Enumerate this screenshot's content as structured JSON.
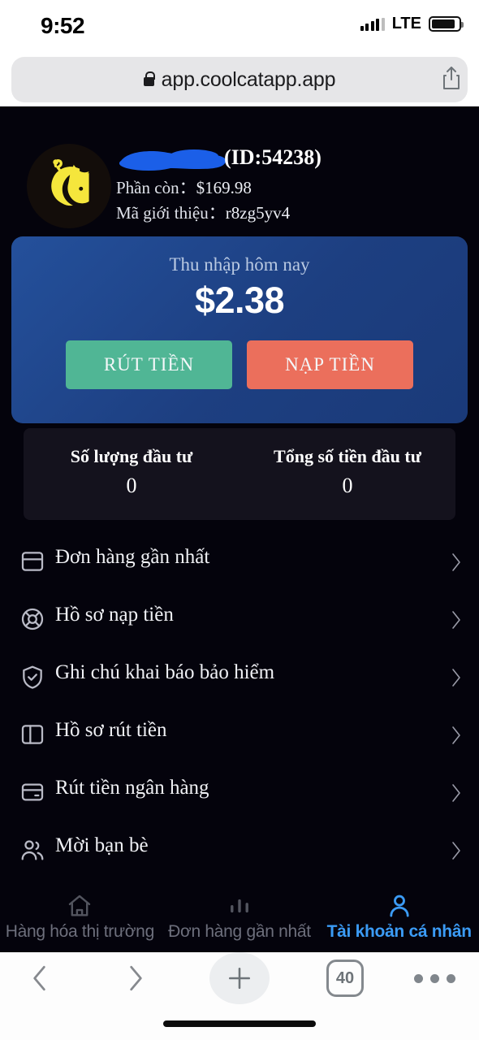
{
  "status_bar": {
    "time": "9:52",
    "network": "LTE"
  },
  "browser": {
    "url": "app.coolcatapp.app",
    "lock_icon": "lock-icon",
    "share_icon": "share-icon",
    "toolbar": {
      "back_icon": "chevron-left-icon",
      "forward_icon": "chevron-right-icon",
      "new_tab_icon": "plus-icon",
      "tab_count": "40",
      "more_icon": "ellipsis-icon"
    }
  },
  "profile": {
    "avatar_icon": "cat-moon-logo",
    "username_redacted": true,
    "id_label": "(ID:54238)",
    "balance_label": "Phần còn：",
    "balance_value": "$169.98",
    "referral_label": "Mã giới thiệu：",
    "referral_value": "r8zg5yv4"
  },
  "earnings_card": {
    "title": "Thu nhập hôm nay",
    "amount": "$2.38",
    "withdraw_button": "RÚT TIỀN",
    "deposit_button": "NẠP TIỀN",
    "card_color": "#1d4289",
    "withdraw_color": "#50b695",
    "deposit_color": "#eb6f5c"
  },
  "stats": [
    {
      "title": "Số lượng đầu tư",
      "value": "0"
    },
    {
      "title": "Tổng số tiền đầu tư",
      "value": "0"
    }
  ],
  "menu": [
    {
      "label": "Đơn hàng gần nhất",
      "icon": "rows-panel-icon"
    },
    {
      "label": "Hồ sơ nạp tiền",
      "icon": "lifebuoy-icon"
    },
    {
      "label": "Ghi chú khai báo bảo hiểm",
      "icon": "shield-check-icon"
    },
    {
      "label": "Hồ sơ rút tiền",
      "icon": "columns-panel-icon"
    },
    {
      "label": "Rút tiền ngân hàng",
      "icon": "credit-card-icon"
    },
    {
      "label": "Mời bạn bè",
      "icon": "users-icon"
    }
  ],
  "app_tabs": [
    {
      "label": "Hàng hóa thị trường",
      "icon": "home-icon",
      "active": false
    },
    {
      "label": "Đơn hàng gần nhất",
      "icon": "bar-chart-icon",
      "active": false
    },
    {
      "label": "Tài khoản cá nhân",
      "icon": "person-icon",
      "active": true
    }
  ],
  "accent_color": "#3b9bf5"
}
